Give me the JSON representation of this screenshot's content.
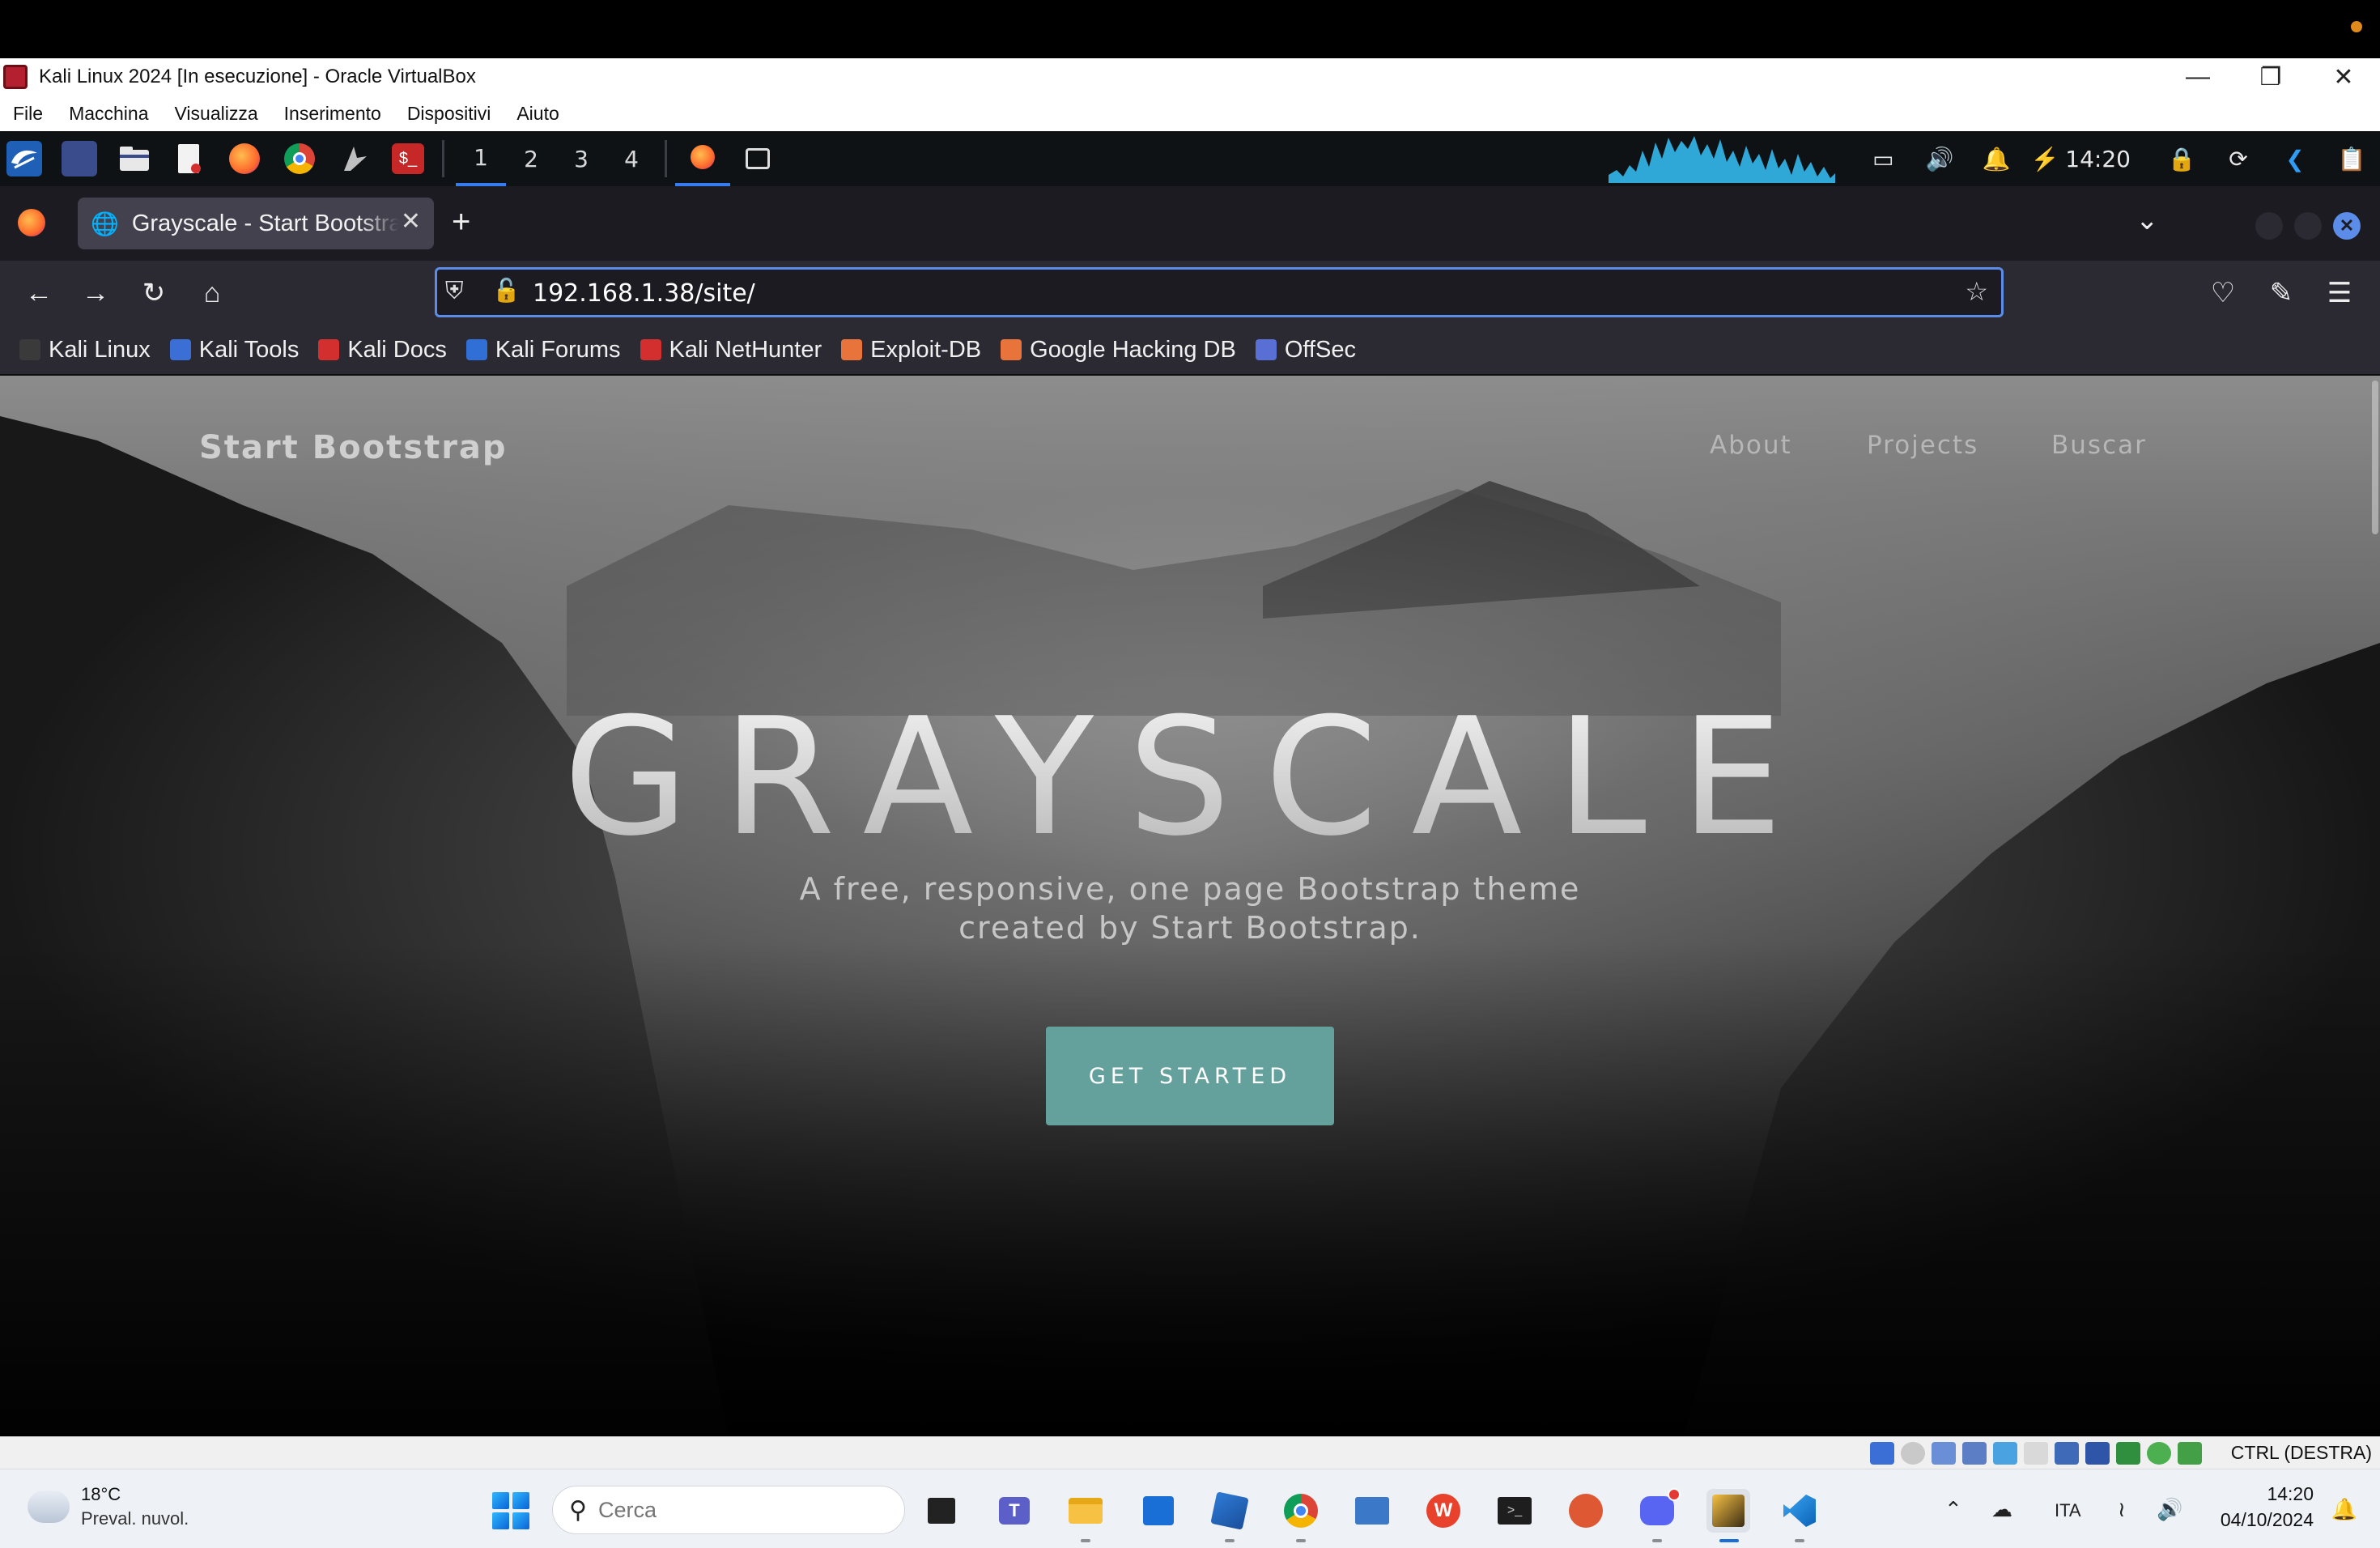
{
  "vbox": {
    "title": "Kali Linux 2024 [In esecuzione] - Oracle VirtualBox",
    "menu": [
      "File",
      "Macchina",
      "Visualizza",
      "Inserimento",
      "Dispositivi",
      "Aiuto"
    ],
    "host_key": "CTRL (DESTRA)"
  },
  "kali_panel": {
    "workspaces": [
      "1",
      "2",
      "3",
      "4"
    ],
    "active_workspace": "1",
    "time": "14:20"
  },
  "browser": {
    "tab_title": "Grayscale - Start Bootstrap",
    "url": "192.168.1.38/site/",
    "bookmarks": [
      {
        "label": "Kali Linux",
        "icon": "kali-dragon-icon",
        "color": "#3a3a3a"
      },
      {
        "label": "Kali Tools",
        "icon": "kali-tools-icon",
        "color": "#3b6fd6"
      },
      {
        "label": "Kali Docs",
        "icon": "kali-docs-icon",
        "color": "#d32f2f"
      },
      {
        "label": "Kali Forums",
        "icon": "kali-forums-icon",
        "color": "#2f6fd6"
      },
      {
        "label": "Kali NetHunter",
        "icon": "nethunter-icon",
        "color": "#d32f2f"
      },
      {
        "label": "Exploit-DB",
        "icon": "exploit-db-icon",
        "color": "#e8743b"
      },
      {
        "label": "Google Hacking DB",
        "icon": "ghdb-icon",
        "color": "#e8743b"
      },
      {
        "label": "OffSec",
        "icon": "offsec-icon",
        "color": "#5a6fd6"
      }
    ]
  },
  "site": {
    "brand": "Start Bootstrap",
    "nav": [
      "About",
      "Projects",
      "Buscar"
    ],
    "hero_title": "GRAYSCALE",
    "hero_subtitle_line1": "A free, responsive, one page Bootstrap theme",
    "hero_subtitle_line2": "created by Start Bootstrap.",
    "cta": "GET STARTED",
    "accent": "#64a19d"
  },
  "taskbar": {
    "temperature": "18°C",
    "condition": "Preval. nuvol.",
    "search_placeholder": "Cerca",
    "language": "ITA",
    "time": "14:20",
    "date": "04/10/2024"
  }
}
